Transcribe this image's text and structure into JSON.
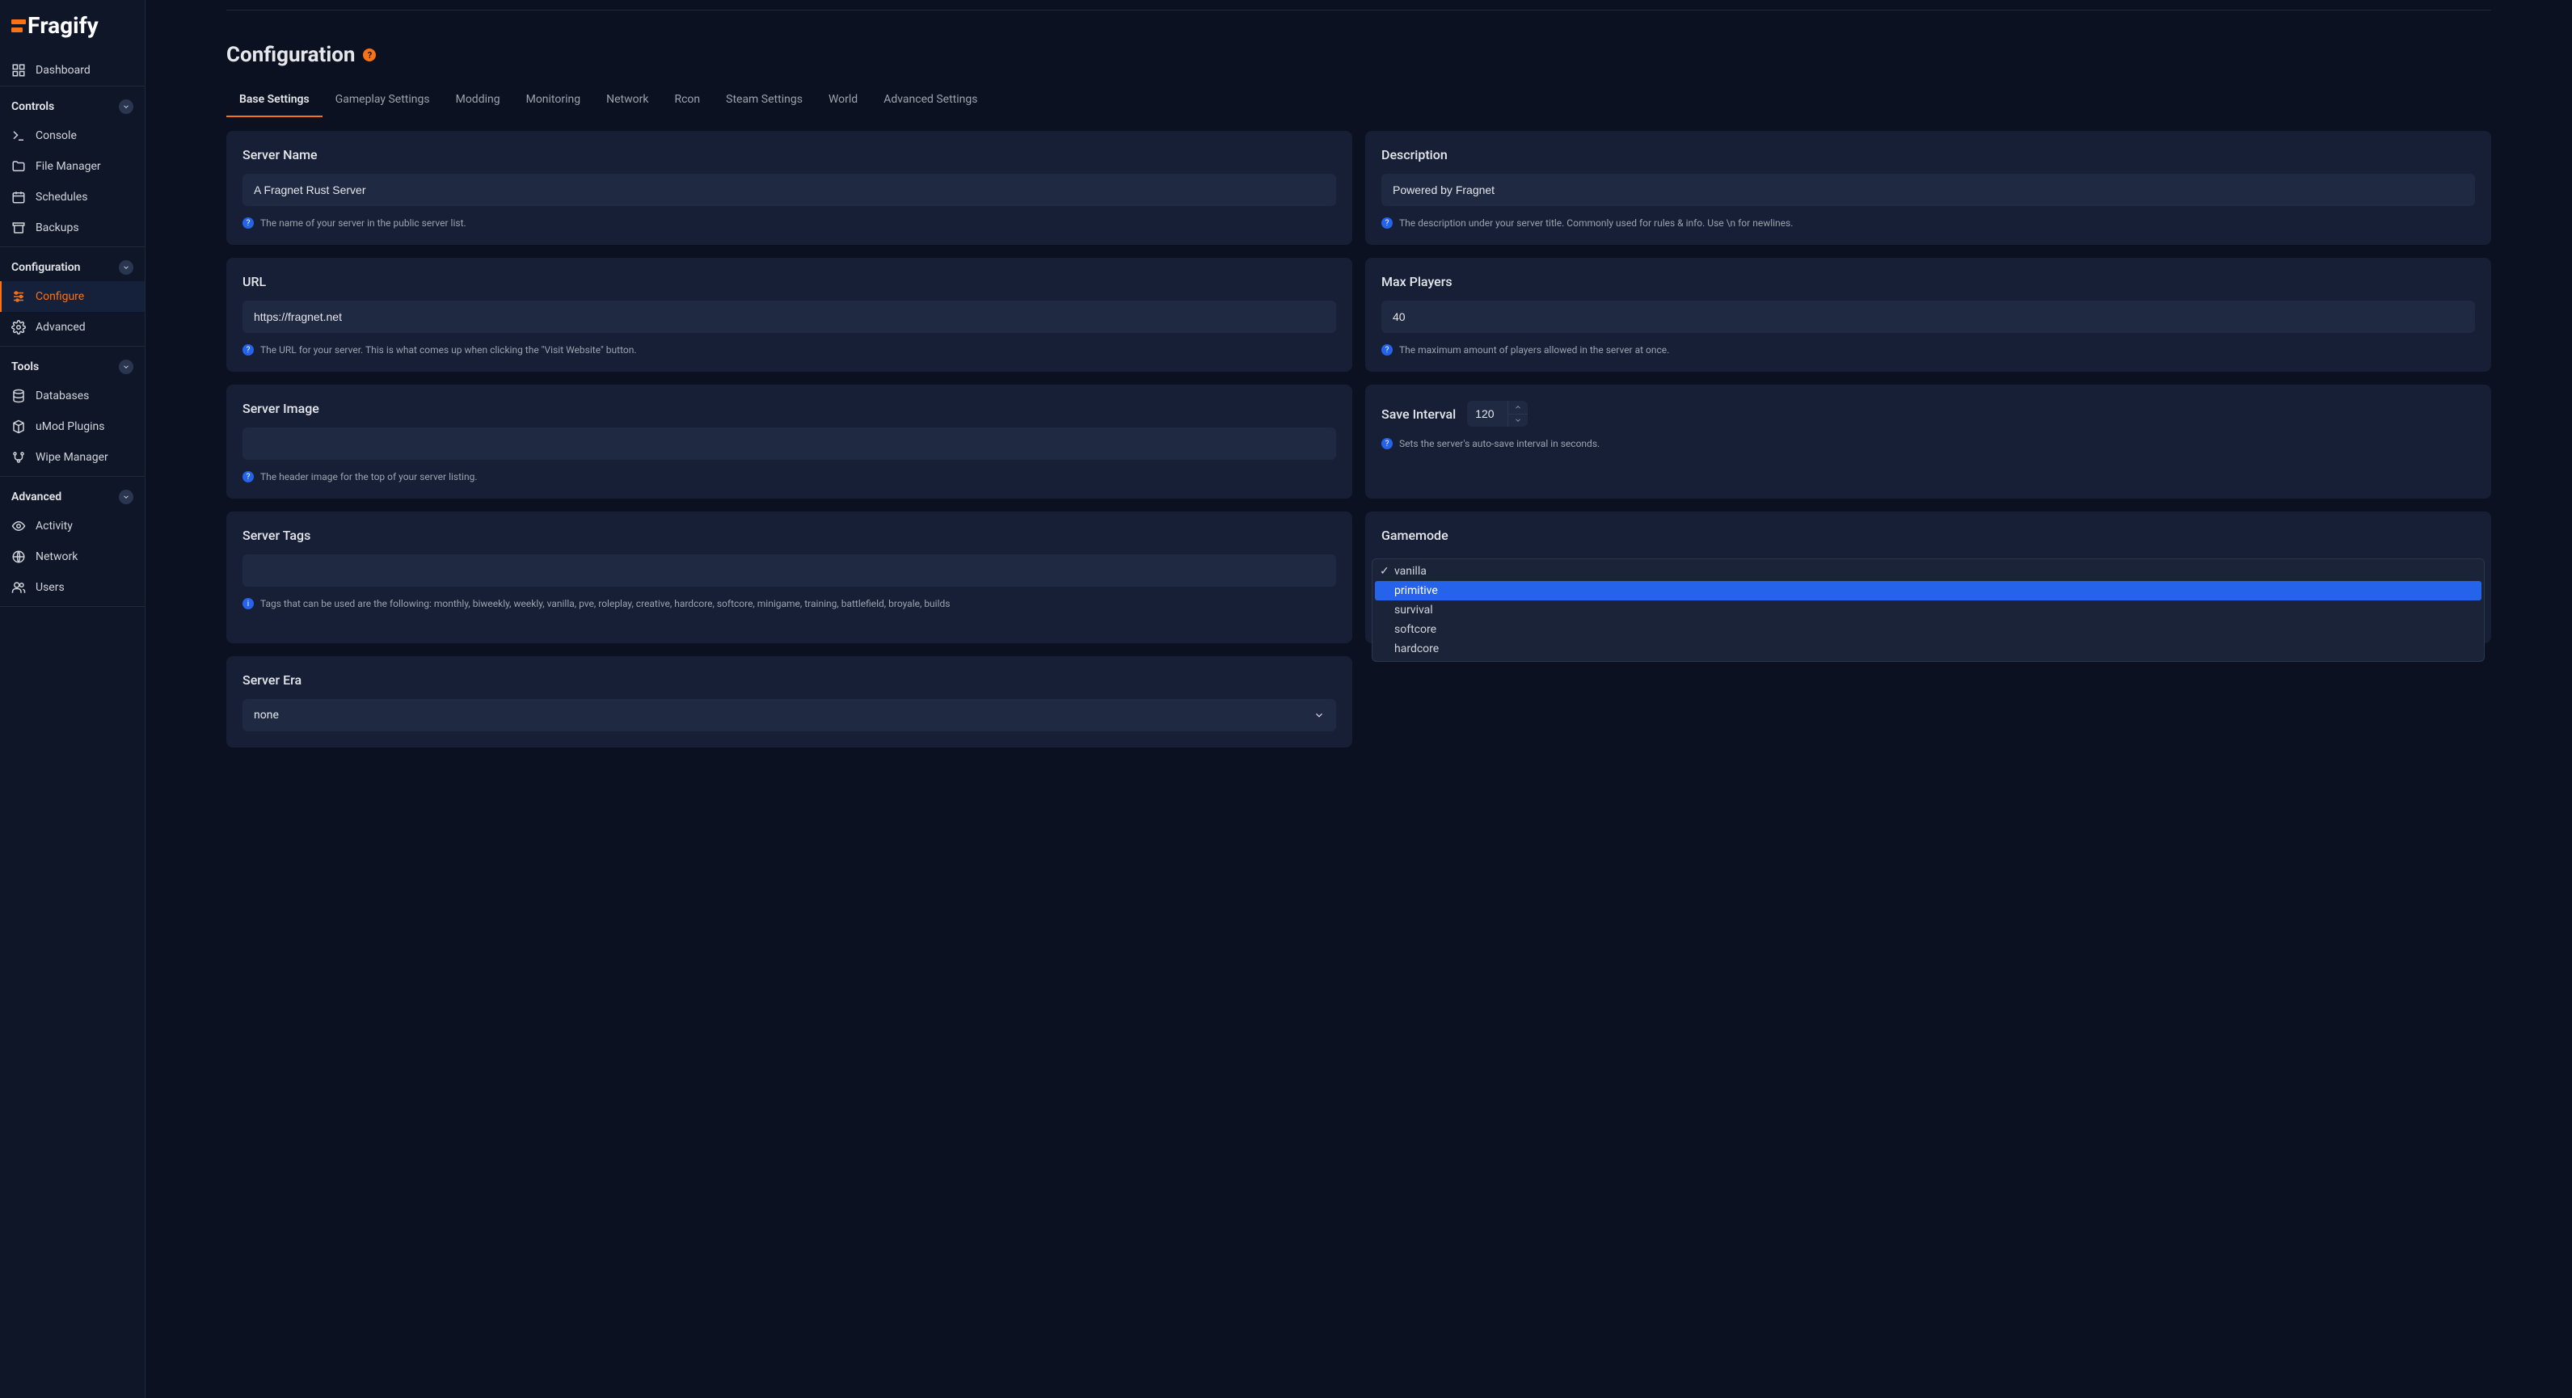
{
  "brand": "ragify",
  "sidebar": {
    "dashboard": "Dashboard",
    "sections": {
      "controls": {
        "title": "Controls",
        "items": [
          "Console",
          "File Manager",
          "Schedules",
          "Backups"
        ]
      },
      "configuration": {
        "title": "Configuration",
        "items": [
          "Configure",
          "Advanced"
        ]
      },
      "tools": {
        "title": "Tools",
        "items": [
          "Databases",
          "uMod Plugins",
          "Wipe Manager"
        ]
      },
      "advanced": {
        "title": "Advanced",
        "items": [
          "Activity",
          "Network",
          "Users"
        ]
      }
    }
  },
  "page": {
    "title": "Configuration",
    "tabs": [
      "Base Settings",
      "Gameplay Settings",
      "Modding",
      "Monitoring",
      "Network",
      "Rcon",
      "Steam Settings",
      "World",
      "Advanced Settings"
    ]
  },
  "fields": {
    "serverName": {
      "label": "Server Name",
      "value": "A Fragnet Rust Server",
      "help": "The name of your server in the public server list."
    },
    "description": {
      "label": "Description",
      "value": "Powered by Fragnet",
      "help": "The description under your server title. Commonly used for rules & info. Use \\n for newlines."
    },
    "url": {
      "label": "URL",
      "value": "https://fragnet.net",
      "help": "The URL for your server. This is what comes up when clicking the \"Visit Website\" button."
    },
    "maxPlayers": {
      "label": "Max Players",
      "value": "40",
      "help": "The maximum amount of players allowed in the server at once."
    },
    "serverImage": {
      "label": "Server Image",
      "value": "",
      "help": "The header image for the top of your server listing."
    },
    "saveInterval": {
      "label": "Save Interval",
      "value": "120",
      "help": "Sets the server's auto-save interval in seconds."
    },
    "serverTags": {
      "label": "Server Tags",
      "value": "",
      "help": "Tags that can be used are the following: monthly, biweekly, weekly, vanilla, pve, roleplay, creative, hardcore, softcore, minigame, training, battlefield, broyale, builds"
    },
    "gamemode": {
      "label": "Gamemode",
      "options": [
        "vanilla",
        "primitive",
        "survival",
        "softcore",
        "hardcore"
      ],
      "selected": "vanilla"
    },
    "serverEra": {
      "label": "Server Era",
      "value": "none"
    }
  }
}
